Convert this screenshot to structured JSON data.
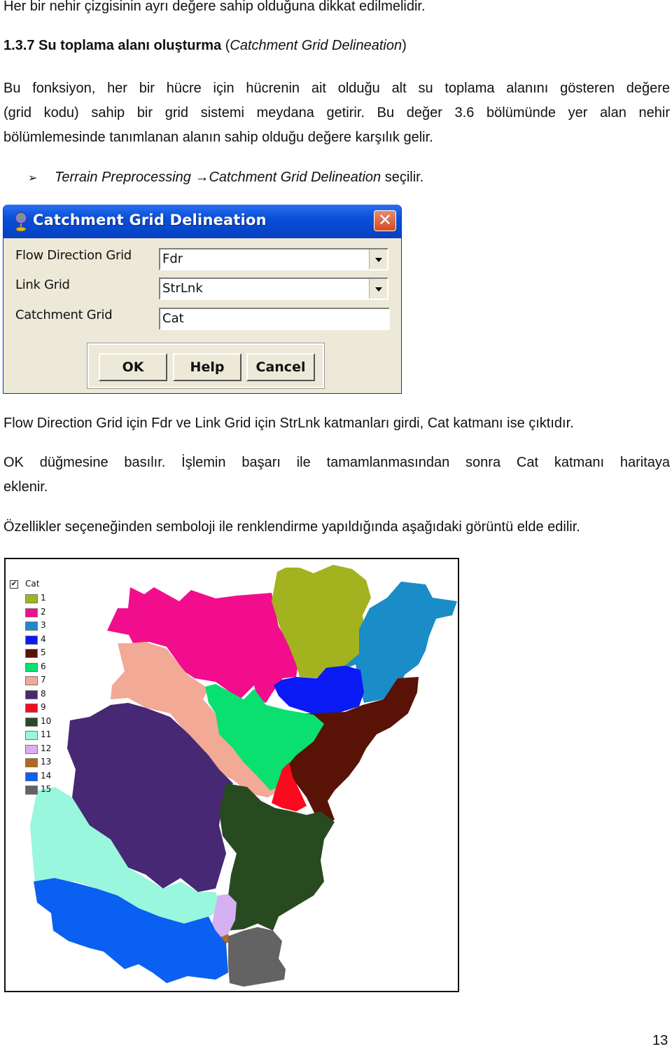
{
  "document": {
    "line1": "Her bir nehir çizgisinin ayrı değere sahip olduğuna dikkat edilmelidir.",
    "section": {
      "number_title": "1.3.7 Su toplama alanı oluşturma",
      "paren_open": " (",
      "english": "Catchment Grid Delineation",
      "paren_close": ")"
    },
    "para1": [
      "Bu fonksiyon, her bir hücre için hücrenin ait olduğu alt su toplama alanını gösteren değere",
      "(grid kodu) sahip bir grid sistemi meydana getirir.  Bu değer 3.6 bölümünde yer alan nehir",
      "bölümlemesinde tanımlanan alanın sahip olduğu değere karşılık gelir."
    ],
    "bullet": {
      "menu": "Terrain Preprocessing",
      "arrow": "→",
      "item": "Catchment Grid Delineation",
      "suffix": " seçilir."
    },
    "para2": "Flow Direction Grid için Fdr ve Link Grid için StrLnk katmanları girdi, Cat katmanı ise çıktıdır.",
    "para3": [
      "OK düğmesine basılır. İşlemin başarı ile tamamlanmasından sonra Cat katmanı haritaya",
      "eklenir."
    ],
    "para4": "Özellikler seçeneğinden semboloji ile renklendirme yapıldığında aşağıdaki görüntü elde edilir.",
    "page_number": "13"
  },
  "dialog": {
    "title": "Catchment Grid Delineation",
    "close_glyph": "✕",
    "fields": [
      {
        "label": "Flow Direction Grid",
        "value": "Fdr",
        "type": "dropdown"
      },
      {
        "label": "Link Grid",
        "value": "StrLnk",
        "type": "dropdown"
      },
      {
        "label": "Catchment Grid",
        "value": "Cat",
        "type": "text"
      }
    ],
    "buttons": {
      "ok": "OK",
      "help": "Help",
      "cancel": "Cancel"
    }
  },
  "map": {
    "layer_name": "Cat",
    "layer_checked": "✔",
    "classes": [
      {
        "value": "1",
        "color": "#a3b21f"
      },
      {
        "value": "2",
        "color": "#f20d8c"
      },
      {
        "value": "3",
        "color": "#1a8cc8"
      },
      {
        "value": "4",
        "color": "#0a1af5"
      },
      {
        "value": "5",
        "color": "#581306"
      },
      {
        "value": "6",
        "color": "#0ae070"
      },
      {
        "value": "7",
        "color": "#f2a996"
      },
      {
        "value": "8",
        "color": "#472874"
      },
      {
        "value": "9",
        "color": "#fa0a1c"
      },
      {
        "value": "10",
        "color": "#284a20"
      },
      {
        "value": "11",
        "color": "#98f7dc"
      },
      {
        "value": "12",
        "color": "#d5b0f2"
      },
      {
        "value": "13",
        "color": "#b06a1c"
      },
      {
        "value": "14",
        "color": "#0a60f0"
      },
      {
        "value": "15",
        "color": "#636363"
      }
    ]
  }
}
